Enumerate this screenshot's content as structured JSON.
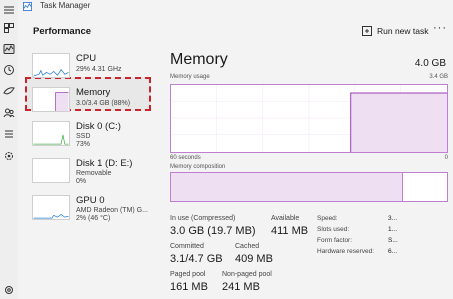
{
  "app": {
    "title": "Task Manager"
  },
  "colors": {
    "accent": "#9b3fb5",
    "graph_border": "#bf7fd0",
    "fill": "#efdff3",
    "highlight": "#c8242b"
  },
  "rail": {
    "icons": [
      "hamburger-icon",
      "processes-icon",
      "performance-icon",
      "history-icon",
      "startup-icon",
      "users-icon",
      "details-icon",
      "services-icon"
    ]
  },
  "header": {
    "title": "Performance",
    "run_task": "Run new task",
    "more": "···"
  },
  "list": [
    {
      "name": "CPU",
      "sub1": "29%  4.31 GHz",
      "sub2": ""
    },
    {
      "name": "Memory",
      "sub1": "3.0/3.4 GB (88%)",
      "sub2": ""
    },
    {
      "name": "Disk 0 (C:)",
      "sub1": "SSD",
      "sub2": "73%"
    },
    {
      "name": "Disk 1 (D: E:)",
      "sub1": "Removable",
      "sub2": "0%"
    },
    {
      "name": "GPU 0",
      "sub1": "AMD Radeon (TM) G...",
      "sub2": "2% (46 °C)"
    }
  ],
  "main": {
    "title": "Memory",
    "total": "4.0 GB",
    "usage_label": "Memory usage",
    "usage_max": "3.4 GB",
    "time_label": "60 seconds",
    "zero": "0",
    "composition_label": "Memory composition",
    "composition_in_use_fraction": 0.84,
    "usage_level_fraction": 0.88,
    "stats": {
      "in_use_label": "In use (Compressed)",
      "in_use_value": "3.0 GB (19.7 MB)",
      "available_label": "Available",
      "available_value": "411 MB",
      "committed_label": "Committed",
      "committed_value": "3.1/4.7 GB",
      "cached_label": "Cached",
      "cached_value": "409 MB",
      "paged_label": "Paged pool",
      "paged_value": "161 MB",
      "nonpaged_label": "Non-paged pool",
      "nonpaged_value": "241 MB"
    },
    "kv": [
      {
        "label": "Speed:",
        "value": "3..."
      },
      {
        "label": "Slots used:",
        "value": "1..."
      },
      {
        "label": "Form factor:",
        "value": "S..."
      },
      {
        "label": "Hardware reserved:",
        "value": "6..."
      }
    ]
  }
}
